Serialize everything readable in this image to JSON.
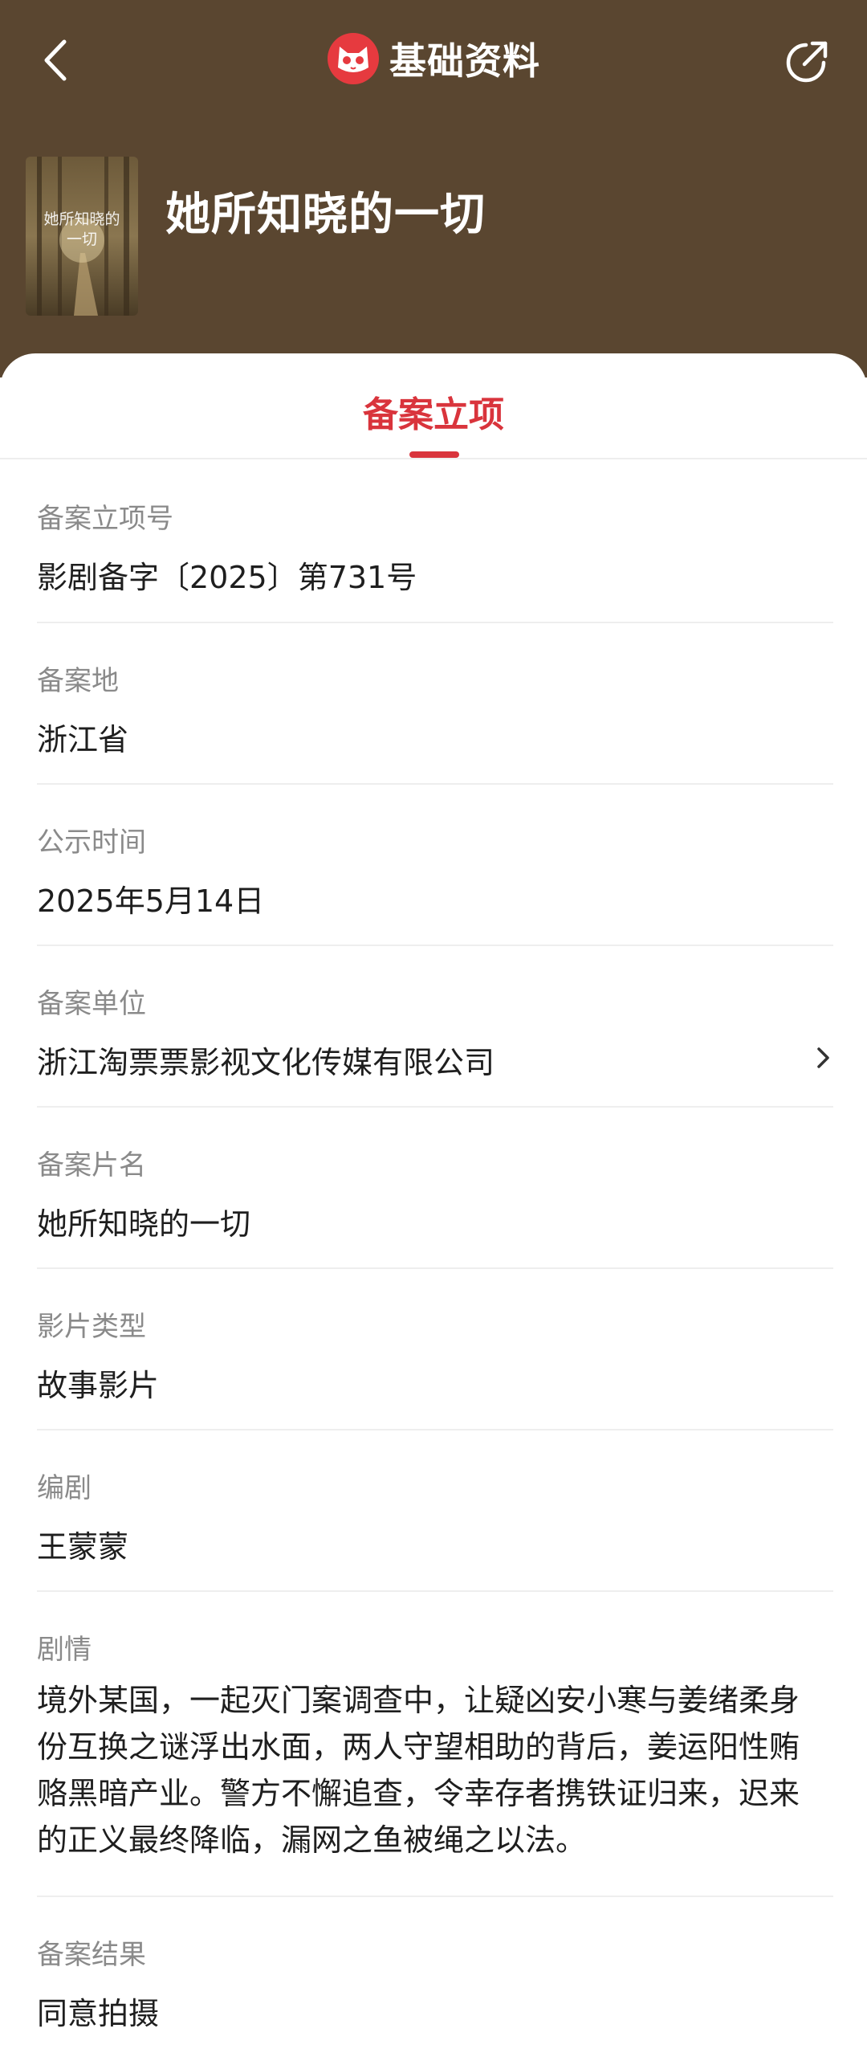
{
  "header": {
    "title": "基础资料",
    "poster_text": [
      "她所知晓的",
      "一切"
    ],
    "movie_title": "她所知晓的一切"
  },
  "tabs": [
    {
      "label": "备案立项",
      "active": true
    }
  ],
  "fields": [
    {
      "label": "备案立项号",
      "value": "影剧备字〔2025〕第731号"
    },
    {
      "label": "备案地",
      "value": "浙江省"
    },
    {
      "label": "公示时间",
      "value": "2025年5月14日"
    },
    {
      "label": "备案单位",
      "value": "浙江淘票票影视文化传媒有限公司"
    },
    {
      "label": "备案片名",
      "value": "她所知晓的一切"
    },
    {
      "label": "影片类型",
      "value": "故事影片"
    },
    {
      "label": "编剧",
      "value": "王蒙蒙"
    },
    {
      "label": "剧情",
      "value": [
        "境外某国，一起灭门案调查中，让疑凶安小寒与姜绪柔身",
        "份互换之谜浮出水面，两人守望相助的背后，姜运阳性贿",
        "赂黑暗产业。警方不懈追查，令幸存者携铁证归来，迟来",
        "的正义最终降临，漏网之鱼被绳之以法。"
      ]
    },
    {
      "label": "备案结果",
      "value": "同意拍摄"
    }
  ],
  "colors": {
    "header_bg": "#5a4630",
    "accent": "#d9343c"
  },
  "icons": [
    "back-arrow-icon",
    "cat-logo-icon",
    "share-icon",
    "chevron-right-icon"
  ]
}
